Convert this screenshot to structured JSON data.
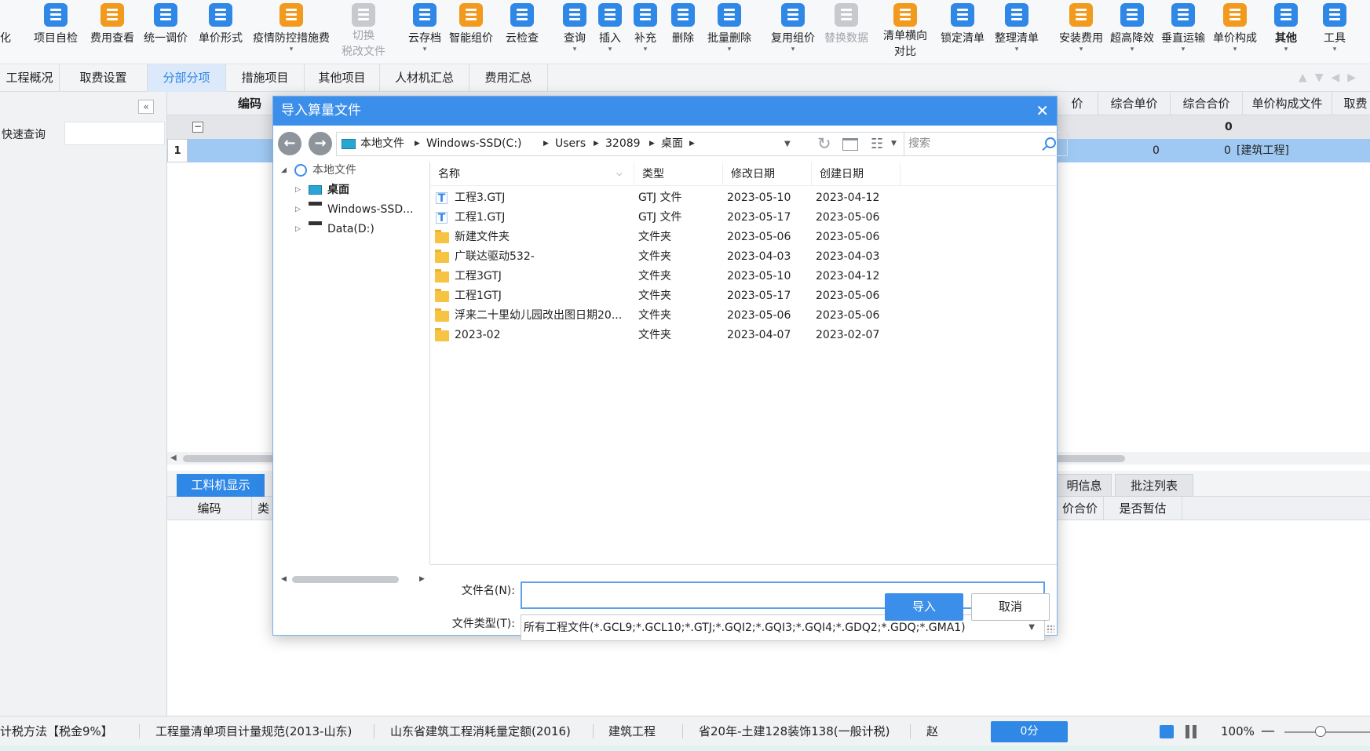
{
  "toolbar": {
    "items": [
      {
        "label": "化",
        "icon": "partial-icon",
        "color": "blue"
      },
      {
        "label": "项目自检",
        "icon": "project-check-icon"
      },
      {
        "label": "费用查看",
        "icon": "fee-view-icon"
      },
      {
        "label": "统一调价",
        "icon": "adjust-price-icon"
      },
      {
        "label": "单价形式",
        "icon": "unit-price-form-icon"
      },
      {
        "label": "疫情防控措施费",
        "icon": "epidemic-fee-icon"
      },
      {
        "label": "切换\n税改文件",
        "icon": "switch-tax-icon"
      },
      {
        "label": "云存档",
        "icon": "cloud-save-icon"
      },
      {
        "label": "智能组价",
        "icon": "smart-pricing-icon"
      },
      {
        "label": "云检查",
        "icon": "cloud-check-icon"
      },
      {
        "label": "查询",
        "icon": "query-icon"
      },
      {
        "label": "插入",
        "icon": "insert-icon"
      },
      {
        "label": "补充",
        "icon": "supplement-icon"
      },
      {
        "label": "删除",
        "icon": "delete-icon"
      },
      {
        "label": "批量删除",
        "icon": "batch-delete-icon"
      },
      {
        "label": "复用组价",
        "icon": "reuse-pricing-icon"
      },
      {
        "label": "替换数据",
        "icon": "replace-data-icon"
      },
      {
        "label": "清单横向\n对比",
        "icon": "list-compare-icon"
      },
      {
        "label": "锁定清单",
        "icon": "lock-list-icon"
      },
      {
        "label": "整理清单",
        "icon": "organize-list-icon"
      },
      {
        "label": "安装费用",
        "icon": "install-fee-icon"
      },
      {
        "label": "超高降效",
        "icon": "high-rise-icon"
      },
      {
        "label": "垂直运输",
        "icon": "vertical-transport-icon"
      },
      {
        "label": "单价构成",
        "icon": "price-composition-icon"
      },
      {
        "label": "其他",
        "icon": "other-icon"
      },
      {
        "label": "工具",
        "icon": "tools-icon"
      }
    ]
  },
  "tabs": [
    "工程概况",
    "取费设置",
    "分部分项",
    "措施项目",
    "其他项目",
    "人材机汇总",
    "费用汇总"
  ],
  "left_pane": {
    "quick_search_label": "快速查询"
  },
  "grid": {
    "headers": {
      "code": "编码",
      "unit_price_partial": "价",
      "comp_unit_price": "综合单价",
      "comp_total": "综合合价",
      "unit_price_file": "单价构成文件",
      "fee": "取费"
    },
    "row0_total": "0",
    "row1": {
      "num": "1",
      "unit_price": "0",
      "total": "0",
      "file": "[建筑工程]"
    }
  },
  "subtabs": {
    "active": "工料机显示",
    "partial_info": "明信息",
    "annotations": "批注列表"
  },
  "subgrid": {
    "code": "编码",
    "type_partial": "类",
    "price_total_partial": "价合价",
    "provisional": "是否暂估"
  },
  "statusbar": {
    "tax_method": "计税方法【税金9%】",
    "norm": "工程量清单项目计量规范(2013-山东)",
    "quota": "山东省建筑工程消耗量定额(2016)",
    "project_type": "建筑工程",
    "rate": "省20年-土建128装饰138(一般计税)",
    "user": "赵",
    "score": "0分",
    "zoom": "100%",
    "zoom_minus": "—"
  },
  "dialog": {
    "title": "导入算量文件",
    "close": "✕",
    "breadcrumbs": [
      "本地文件",
      "Windows-SSD(C:)",
      "Users",
      "32089",
      "桌面"
    ],
    "search_placeholder": "搜索",
    "tree": {
      "root": "本地文件",
      "children": [
        "桌面",
        "Windows-SSD...",
        "Data(D:)"
      ]
    },
    "columns": {
      "name": "名称",
      "type": "类型",
      "modified": "修改日期",
      "created": "创建日期"
    },
    "files": [
      {
        "name": "工程3.GTJ",
        "type": "GTJ 文件",
        "modified": "2023-05-10",
        "created": "2023-04-12",
        "kind": "gtj"
      },
      {
        "name": "工程1.GTJ",
        "type": "GTJ 文件",
        "modified": "2023-05-17",
        "created": "2023-05-06",
        "kind": "gtj"
      },
      {
        "name": "新建文件夹",
        "type": "文件夹",
        "modified": "2023-05-06",
        "created": "2023-05-06",
        "kind": "folder"
      },
      {
        "name": "广联达驱动532-",
        "type": "文件夹",
        "modified": "2023-04-03",
        "created": "2023-04-03",
        "kind": "folder"
      },
      {
        "name": "工程3GTJ",
        "type": "文件夹",
        "modified": "2023-05-10",
        "created": "2023-04-12",
        "kind": "folder"
      },
      {
        "name": "工程1GTJ",
        "type": "文件夹",
        "modified": "2023-05-17",
        "created": "2023-05-06",
        "kind": "folder"
      },
      {
        "name": "浮来二十里幼儿园改出图日期20...",
        "type": "文件夹",
        "modified": "2023-05-06",
        "created": "2023-05-06",
        "kind": "folder"
      },
      {
        "name": "2023-02",
        "type": "文件夹",
        "modified": "2023-04-07",
        "created": "2023-02-07",
        "kind": "folder"
      }
    ],
    "filename_label": "文件名(N):",
    "filename_value": "",
    "filetype_label": "文件类型(T):",
    "filetype_value": "所有工程文件(*.GCL9;*.GCL10;*.GTJ;*.GQI2;*.GQI3;*.GQI4;*.GDQ2;*.GDQ;*.GMA1)",
    "import_button": "导入",
    "cancel_button": "取消"
  },
  "colors": {
    "accent": "#3b8ee9",
    "selected_row": "#9fc9f3",
    "folder": "#f6c342"
  }
}
